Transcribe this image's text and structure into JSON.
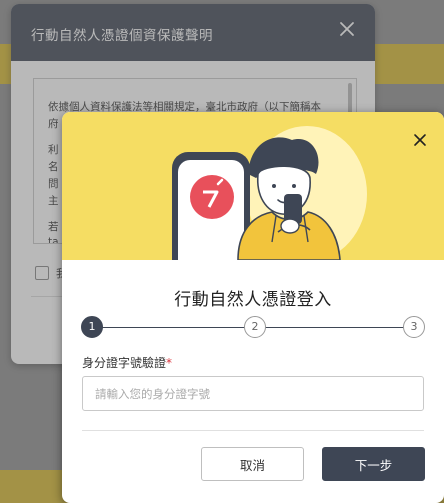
{
  "privacy_dialog": {
    "title": "行動自然人憑證個資保護聲明",
    "close_icon": "close-icon",
    "lines": [
      "依據個人資料保護法等相關規定，臺北市政府（以下簡稱本",
      "府",
      "利",
      "名",
      "問",
      "主",
      "若",
      "ta"
    ],
    "checkbox_label": "我"
  },
  "login_dialog": {
    "close_icon": "close-icon",
    "hero_illustration": "person-holding-phone-illustration",
    "title": "行動自然人憑證登入",
    "steps": [
      "1",
      "2",
      "3"
    ],
    "current_step": 1,
    "id_field": {
      "label": "身分證字號驗證",
      "required_mark": "*",
      "placeholder": "請輸入您的身分證字號",
      "value": ""
    },
    "cancel_label": "取消",
    "next_label": "下一步"
  },
  "colors": {
    "header": "#3e4655",
    "hero_bg": "#f5dd63",
    "accent_red": "#e8505b",
    "primary_button": "#3e4655"
  }
}
